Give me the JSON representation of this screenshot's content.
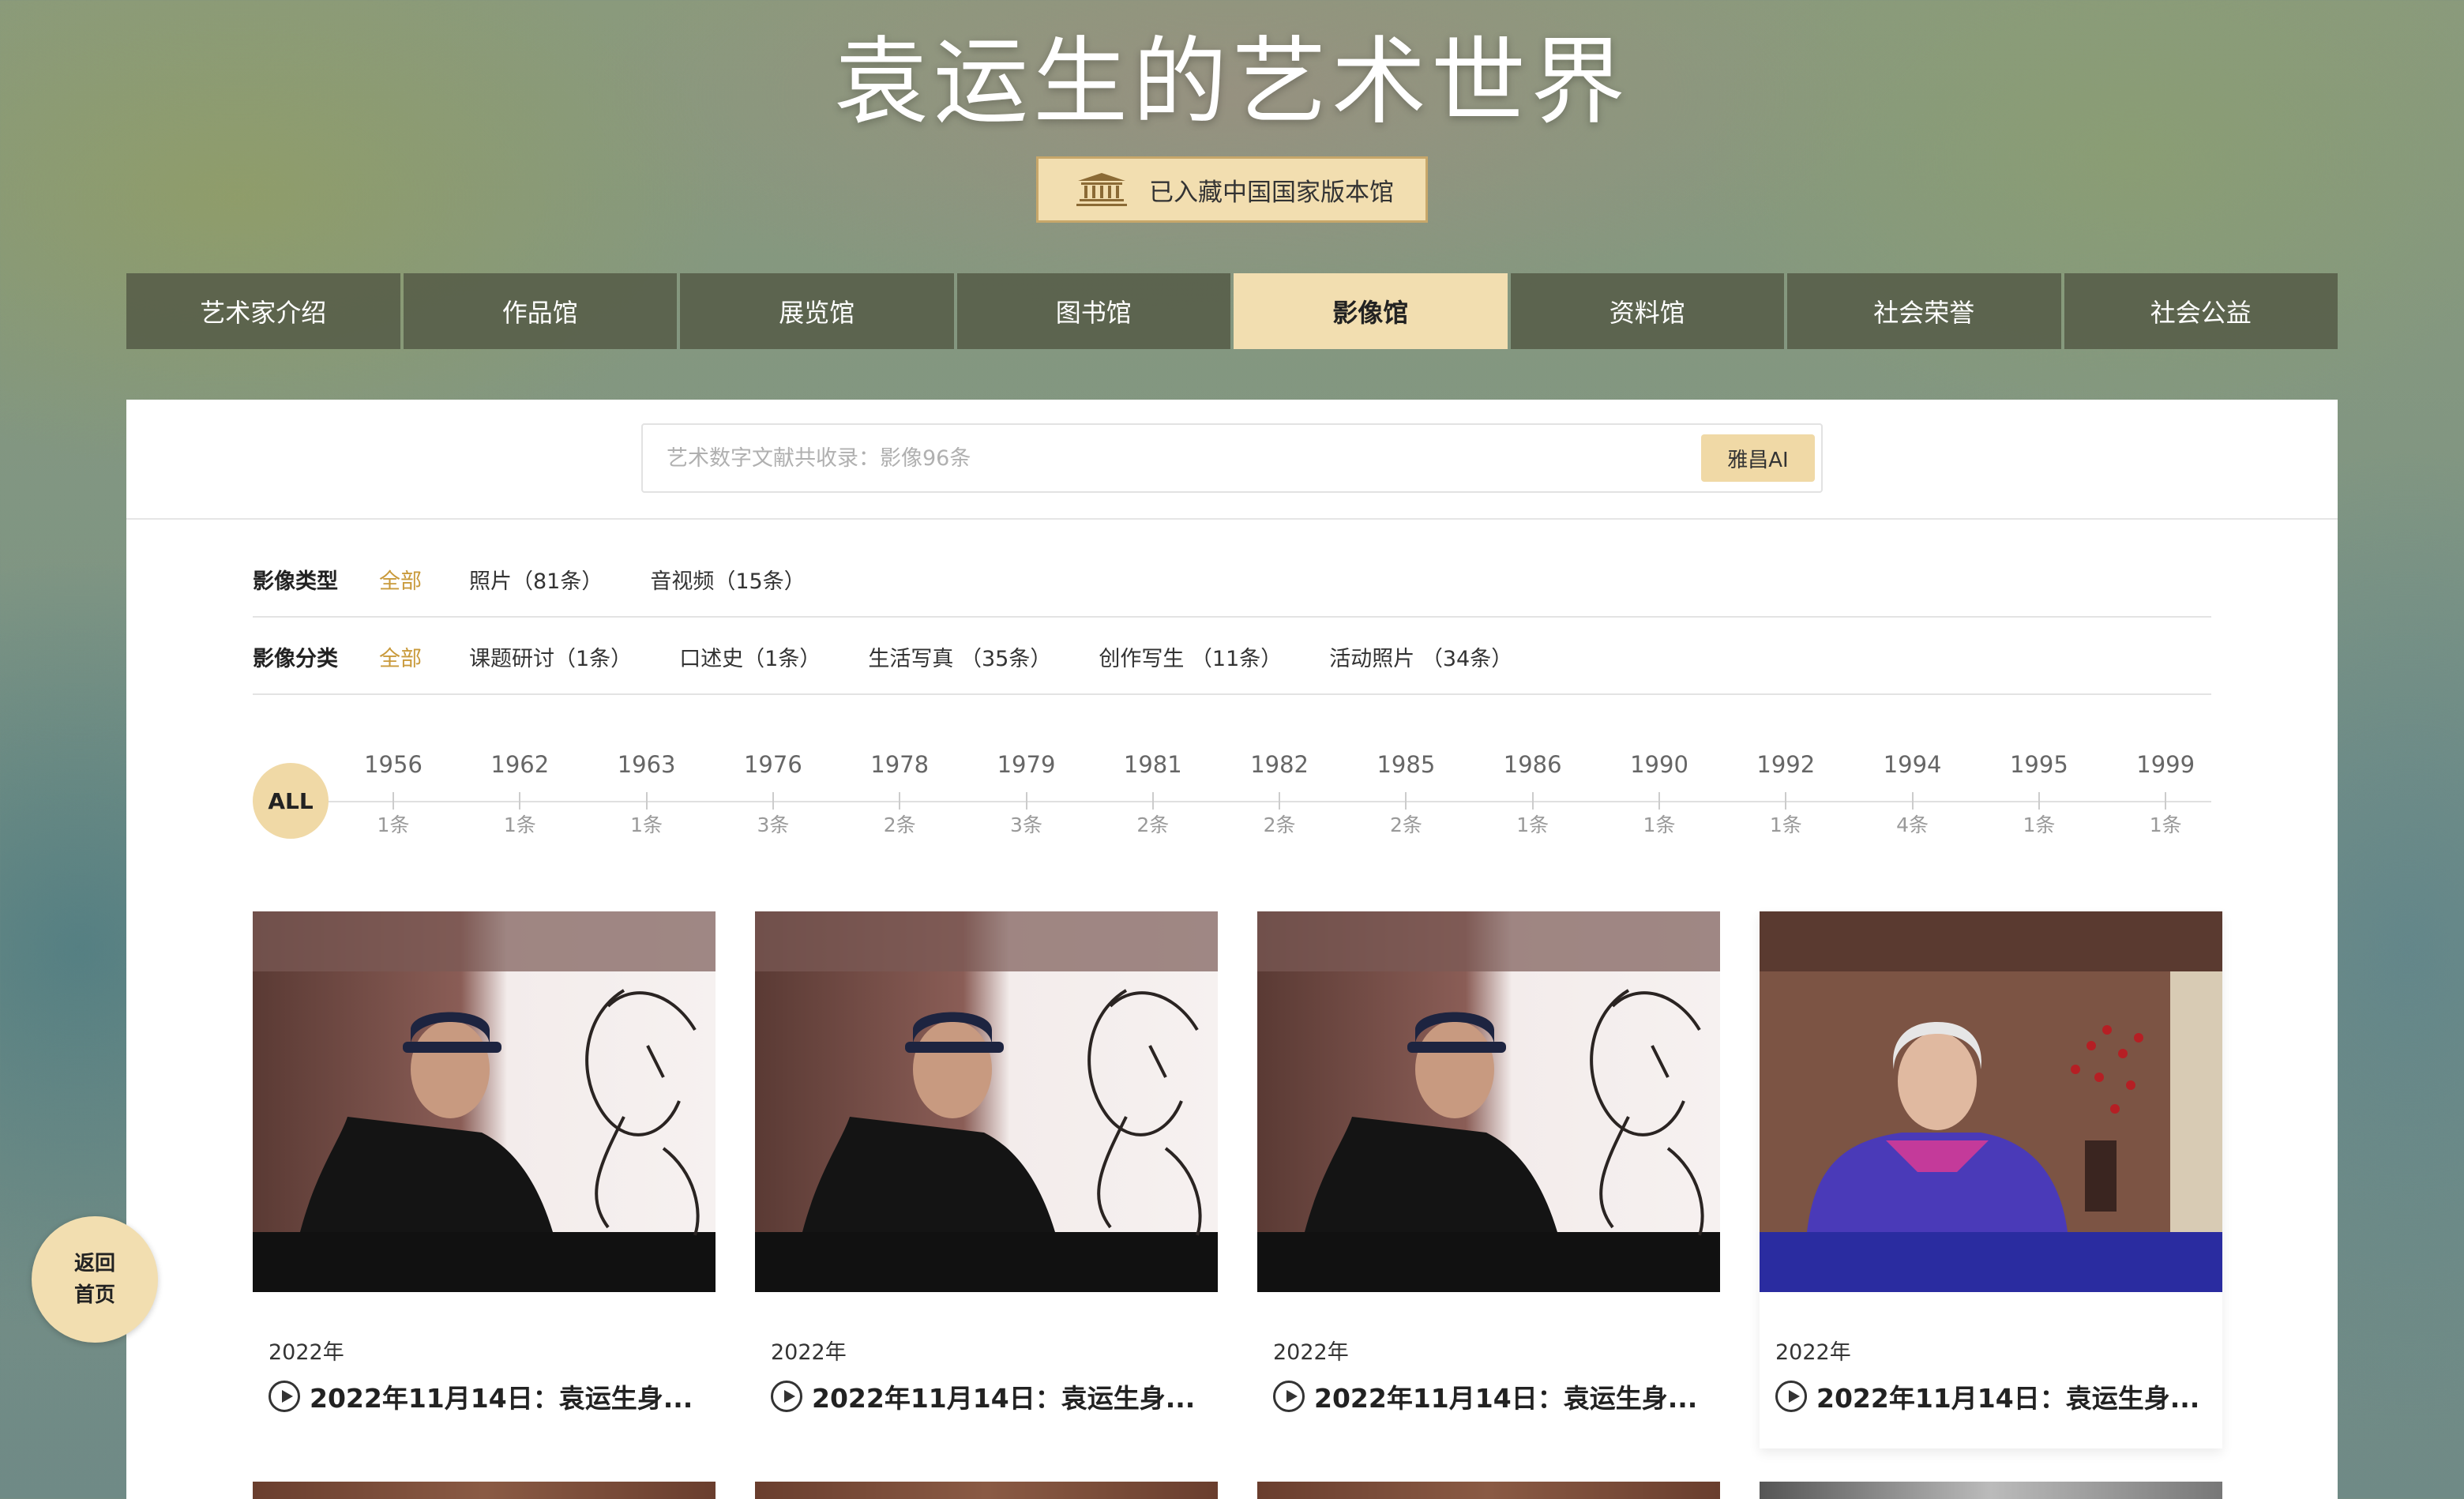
{
  "header": {
    "title": "袁运生的艺术世界",
    "collection_badge": "已入藏中国国家版本馆",
    "badge_icon": "national-archives-building-icon"
  },
  "nav": {
    "items": [
      {
        "label": "艺术家介绍",
        "active": false
      },
      {
        "label": "作品馆",
        "active": false
      },
      {
        "label": "展览馆",
        "active": false
      },
      {
        "label": "图书馆",
        "active": false
      },
      {
        "label": "影像馆",
        "active": true
      },
      {
        "label": "资料馆",
        "active": false
      },
      {
        "label": "社会荣誉",
        "active": false
      },
      {
        "label": "社会公益",
        "active": false
      }
    ]
  },
  "search": {
    "placeholder": "艺术数字文献共收录：影像96条",
    "ai_button": "雅昌AI"
  },
  "filters": {
    "type": {
      "label": "影像类型",
      "options": [
        "全部",
        "照片（81条）",
        "音视频（15条）"
      ],
      "selected": "全部"
    },
    "category": {
      "label": "影像分类",
      "options": [
        "全部",
        "课题研讨（1条）",
        "口述史（1条）",
        "生活写真 （35条）",
        "创作写生 （11条）",
        "活动照片 （34条）"
      ],
      "selected": "全部"
    }
  },
  "timeline": {
    "all_label": "ALL",
    "years": [
      {
        "year": "1956",
        "count": "1条"
      },
      {
        "year": "1962",
        "count": "1条"
      },
      {
        "year": "1963",
        "count": "1条"
      },
      {
        "year": "1976",
        "count": "3条"
      },
      {
        "year": "1978",
        "count": "2条"
      },
      {
        "year": "1979",
        "count": "3条"
      },
      {
        "year": "1981",
        "count": "2条"
      },
      {
        "year": "1982",
        "count": "2条"
      },
      {
        "year": "1985",
        "count": "2条"
      },
      {
        "year": "1986",
        "count": "1条"
      },
      {
        "year": "1990",
        "count": "1条"
      },
      {
        "year": "1992",
        "count": "1条"
      },
      {
        "year": "1994",
        "count": "4条"
      },
      {
        "year": "1995",
        "count": "1条"
      },
      {
        "year": "1999",
        "count": "1条"
      }
    ]
  },
  "cards": [
    {
      "year": "2022年",
      "title": "2022年11月14日：袁运生身...",
      "icon": "play-icon"
    },
    {
      "year": "2022年",
      "title": "2022年11月14日：袁运生身...",
      "icon": "play-icon"
    },
    {
      "year": "2022年",
      "title": "2022年11月14日：袁运生身...",
      "icon": "play-icon"
    },
    {
      "year": "2022年",
      "title": "2022年11月14日：袁运生身...",
      "icon": "play-icon"
    }
  ],
  "home_button": {
    "line1": "返回",
    "line2": "首页"
  },
  "colors": {
    "accent": "#f2deb0",
    "active_filter": "#c99a3b",
    "nav_bg": "#555a46"
  }
}
